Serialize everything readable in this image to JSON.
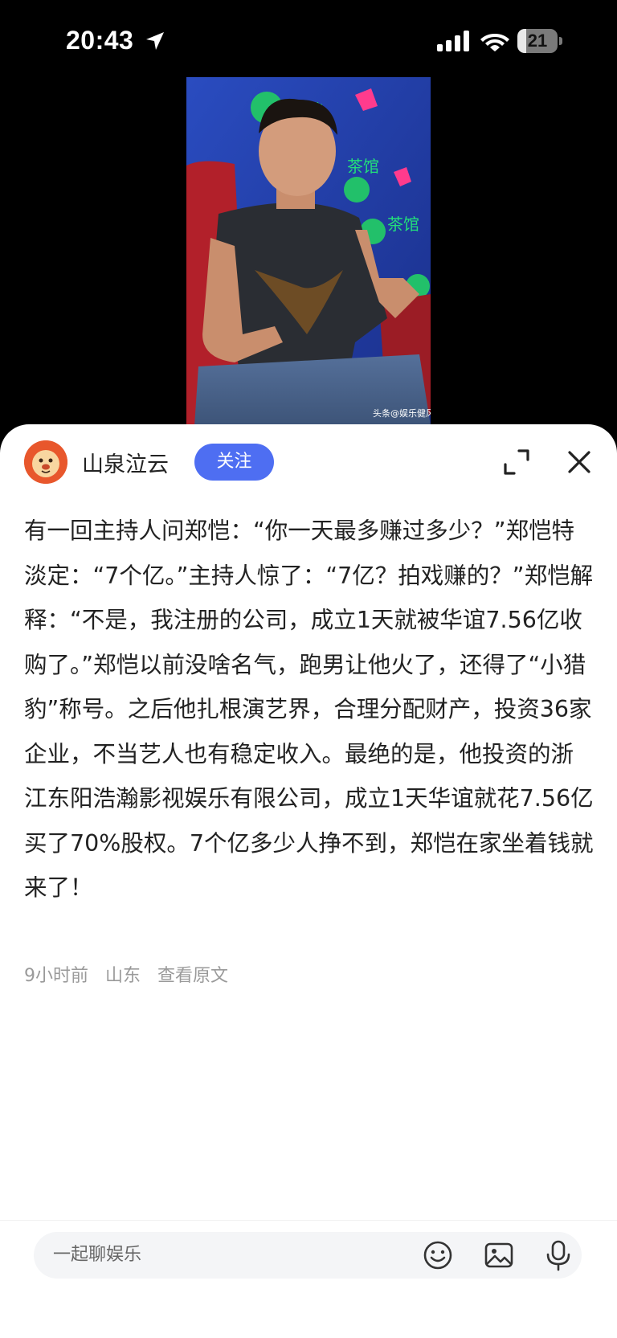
{
  "status_bar": {
    "time": "20:43",
    "battery_level": "21",
    "battery_fraction": 0.21,
    "icons": [
      "location-arrow-icon",
      "cellular-signal-icon",
      "wifi-icon",
      "battery-icon"
    ]
  },
  "photo": {
    "watermark": "头条@娱乐健风",
    "backdrop_text": [
      "茶馆",
      "茶馆",
      "茶馆"
    ]
  },
  "author": {
    "name": "山泉泣云",
    "follow_label": "关注",
    "accent_color": "#4e6ef2"
  },
  "post": {
    "text": "有一回主持人问郑恺：“你一天最多赚过多少？”郑恺特淡定：“7个亿。”主持人惊了：“7亿？拍戏赚的？”郑恺解释：“不是，我注册的公司，成立1天就被华谊7.56亿收购了。”郑恺以前没啥名气，跑男让他火了，还得了“小猎豹”称号。之后他扎根演艺界，合理分配财产，投资36家企业，不当艺人也有稳定收入。最绝的是，他投资的浙江东阳浩瀚影视娱乐有限公司，成立1天华谊就花7.56亿买了70%股权。7个亿多少人挣不到，郑恺在家坐着钱就来了！",
    "time_ago": "9小时前",
    "location": "山东",
    "view_original": "查看原文"
  },
  "comment_bar": {
    "placeholder": "一起聊娱乐",
    "icons": [
      "emoji-icon",
      "image-icon",
      "microphone-icon"
    ]
  },
  "header_icons": [
    "expand-icon",
    "close-icon"
  ]
}
